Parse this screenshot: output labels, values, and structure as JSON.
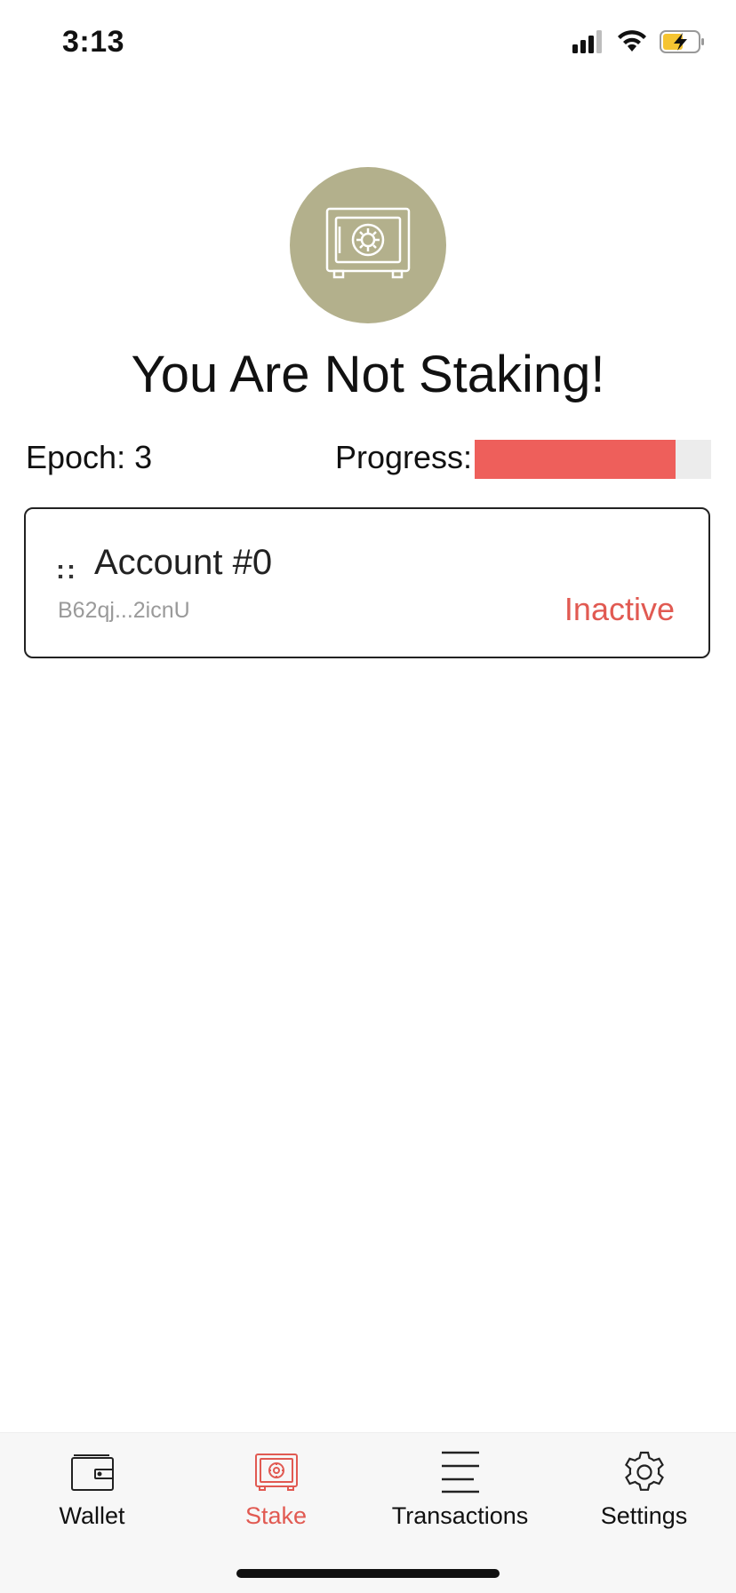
{
  "status_bar": {
    "time": "3:13",
    "icons": [
      "signal-icon",
      "wifi-icon",
      "battery-charging-icon"
    ],
    "battery_color": "#f5c431"
  },
  "hero": {
    "icon": "safe-icon",
    "icon_bg_color": "#b3b08c",
    "title": "You Are Not Staking!"
  },
  "epoch": {
    "label": "Epoch: 3"
  },
  "progress": {
    "label": "Progress:",
    "fraction": 0.85,
    "fill_color": "#ee5f5b"
  },
  "account": {
    "handle": "::",
    "name": "Account #0",
    "address": "B62qj...2icnU",
    "status": "Inactive",
    "status_color": "#e15a52"
  },
  "tab_bar": {
    "active": "stake",
    "accent_color": "#e15a52",
    "tabs": [
      {
        "id": "wallet",
        "label": "Wallet",
        "icon": "wallet-icon"
      },
      {
        "id": "stake",
        "label": "Stake",
        "icon": "safe-icon"
      },
      {
        "id": "transactions",
        "label": "Transactions",
        "icon": "list-icon"
      },
      {
        "id": "settings",
        "label": "Settings",
        "icon": "gear-icon"
      }
    ]
  }
}
